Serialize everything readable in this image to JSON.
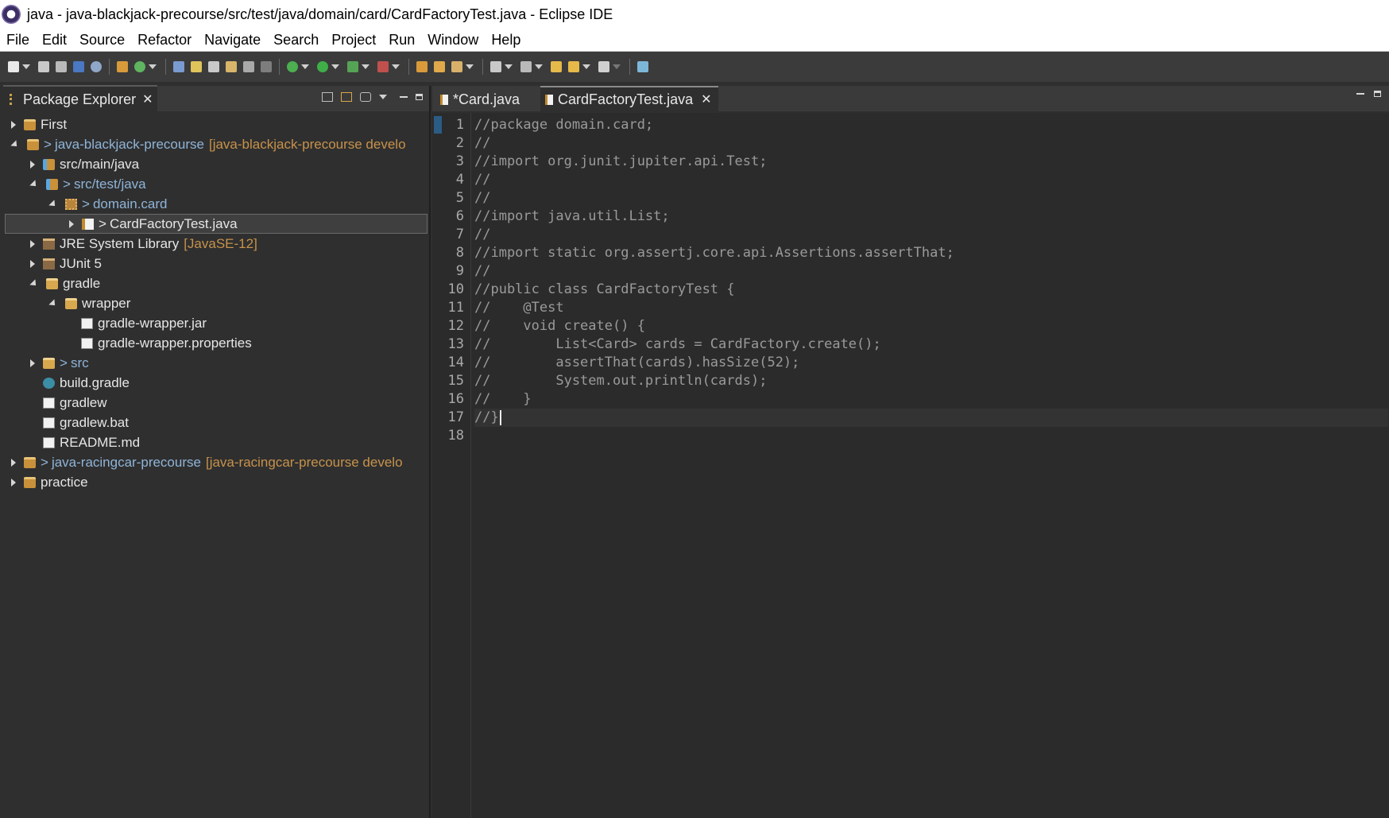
{
  "window": {
    "title": "java - java-blackjack-precourse/src/test/java/domain/card/CardFactoryTest.java - Eclipse IDE"
  },
  "menu": [
    "File",
    "Edit",
    "Source",
    "Refactor",
    "Navigate",
    "Search",
    "Project",
    "Run",
    "Window",
    "Help"
  ],
  "package_explorer": {
    "title": "Package Explorer",
    "tree": [
      {
        "label": "First",
        "prefix": "",
        "suffix": "",
        "state": "closed",
        "icon": "project-icon"
      },
      {
        "label": "java-blackjack-precourse",
        "prefix": ">",
        "suffix": "[java-blackjack-precourse develo",
        "state": "open",
        "icon": "project-icon"
      },
      {
        "label": "src/main/java",
        "prefix": "",
        "suffix": "",
        "state": "closed",
        "icon": "source-folder-icon"
      },
      {
        "label": "src/test/java",
        "prefix": ">",
        "suffix": "",
        "state": "open",
        "icon": "source-folder-icon"
      },
      {
        "label": "domain.card",
        "prefix": ">",
        "suffix": "",
        "state": "open",
        "icon": "package-icon"
      },
      {
        "label": "CardFactoryTest.java",
        "prefix": ">",
        "suffix": "",
        "state": "closed",
        "icon": "java-file-icon"
      },
      {
        "label": "JRE System Library",
        "prefix": "",
        "suffix": "[JavaSE-12]",
        "state": "closed",
        "icon": "library-icon"
      },
      {
        "label": "JUnit 5",
        "prefix": "",
        "suffix": "",
        "state": "closed",
        "icon": "library-icon"
      },
      {
        "label": "gradle",
        "prefix": "",
        "suffix": "",
        "state": "open",
        "icon": "folder-icon"
      },
      {
        "label": "wrapper",
        "prefix": "",
        "suffix": "",
        "state": "open",
        "icon": "folder-icon"
      },
      {
        "label": "gradle-wrapper.jar",
        "prefix": "",
        "suffix": "",
        "state": "leaf",
        "icon": "file-icon"
      },
      {
        "label": "gradle-wrapper.properties",
        "prefix": "",
        "suffix": "",
        "state": "leaf",
        "icon": "file-icon"
      },
      {
        "label": "src",
        "prefix": ">",
        "suffix": "",
        "state": "closed",
        "icon": "folder-icon"
      },
      {
        "label": "build.gradle",
        "prefix": "",
        "suffix": "",
        "state": "leaf",
        "icon": "gradle-file-icon"
      },
      {
        "label": "gradlew",
        "prefix": "",
        "suffix": "",
        "state": "leaf",
        "icon": "file-icon"
      },
      {
        "label": "gradlew.bat",
        "prefix": "",
        "suffix": "",
        "state": "leaf",
        "icon": "file-icon"
      },
      {
        "label": "README.md",
        "prefix": "",
        "suffix": "",
        "state": "leaf",
        "icon": "file-icon"
      },
      {
        "label": "java-racingcar-precourse",
        "prefix": ">",
        "suffix": "[java-racingcar-precourse develo",
        "state": "closed",
        "icon": "project-icon"
      },
      {
        "label": "practice",
        "prefix": "",
        "suffix": "",
        "state": "closed",
        "icon": "project-icon"
      }
    ]
  },
  "editor": {
    "tabs": [
      {
        "label": "*Card.java",
        "active": false
      },
      {
        "label": "CardFactoryTest.java",
        "active": true
      }
    ],
    "lines": [
      "//package domain.card;",
      "//",
      "//import org.junit.jupiter.api.Test;",
      "//",
      "//",
      "//import java.util.List;",
      "//",
      "//import static org.assertj.core.api.Assertions.assertThat;",
      "//",
      "//public class CardFactoryTest {",
      "//    @Test",
      "//    void create() {",
      "//        List<Card> cards = CardFactory.create();",
      "//        assertThat(cards).hasSize(52);",
      "//        System.out.println(cards);",
      "//    }",
      "//}",
      ""
    ],
    "current_line": 17
  },
  "colors": {
    "background": "#2f2f2f",
    "comment_text": "#9a9a9a",
    "decoration": "#c7924b",
    "link_blue": "#8fb4d8"
  }
}
